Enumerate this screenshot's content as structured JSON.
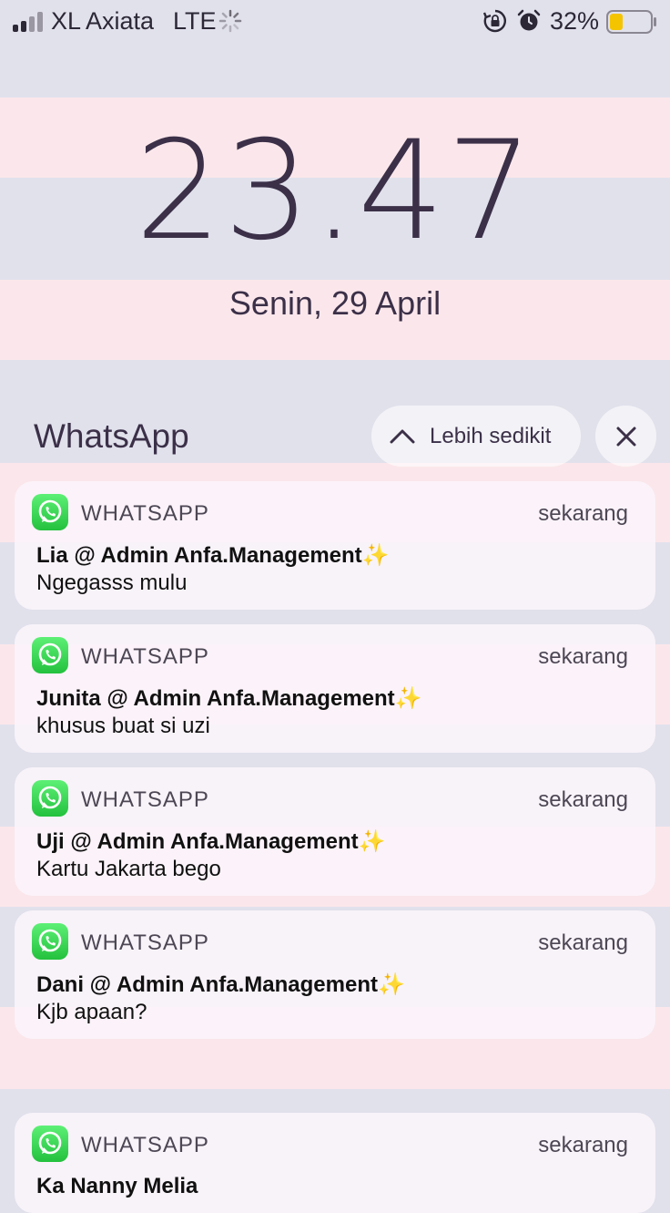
{
  "status_bar": {
    "carrier": "XL Axiata",
    "network": "LTE",
    "battery_percent": "32%",
    "battery_level": 0.32,
    "battery_color": "#f5c400",
    "icons": [
      "signal-icon",
      "loading-spinner-icon",
      "rotation-lock-icon",
      "alarm-icon",
      "battery-icon"
    ]
  },
  "lock_screen": {
    "time": "23.47",
    "date": "Senin, 29 April"
  },
  "group": {
    "title": "WhatsApp",
    "show_less_label": "Lebih sedikit",
    "show_less_icon": "chevron-up-icon",
    "close_icon": "close-icon"
  },
  "notifications": [
    {
      "app": "WHATSAPP",
      "time": "sekarang",
      "sender": "Lia @ Admin Anfa.Management",
      "emoji": "✨",
      "message": "Ngegasss mulu"
    },
    {
      "app": "WHATSAPP",
      "time": "sekarang",
      "sender": "Junita @ Admin Anfa.Management",
      "emoji": "✨",
      "message": "khusus buat si uzi"
    },
    {
      "app": "WHATSAPP",
      "time": "sekarang",
      "sender": "Uji @ Admin Anfa.Management",
      "emoji": "✨",
      "message": "Kartu Jakarta bego"
    },
    {
      "app": "WHATSAPP",
      "time": "sekarang",
      "sender": "Dani @ Admin Anfa.Management",
      "emoji": "✨",
      "message": "Kjb apaan?"
    },
    {
      "app": "WHATSAPP",
      "time": "sekarang",
      "sender": "Ka Nanny Melia",
      "emoji": "",
      "message": ""
    }
  ],
  "colors": {
    "whatsapp_green": "#25d366",
    "text_dark": "#3b3048"
  }
}
